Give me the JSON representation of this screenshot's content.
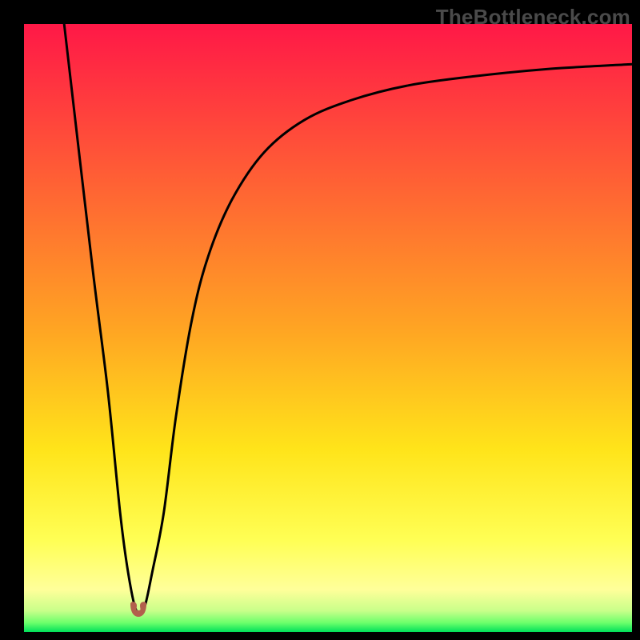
{
  "watermark": "TheBottleneck.com",
  "colors": {
    "frame_bg": "#000000",
    "curve_stroke": "#000000",
    "marker_fill": "#b2604c",
    "gradient_stops": [
      {
        "offset": 0.0,
        "hex": "#ff1847"
      },
      {
        "offset": 0.5,
        "hex": "#ffa423"
      },
      {
        "offset": 0.7,
        "hex": "#ffe41a"
      },
      {
        "offset": 0.85,
        "hex": "#ffff55"
      },
      {
        "offset": 0.93,
        "hex": "#ffff9a"
      },
      {
        "offset": 0.965,
        "hex": "#c9ff8a"
      },
      {
        "offset": 0.985,
        "hex": "#6bff6b"
      },
      {
        "offset": 1.0,
        "hex": "#00e05a"
      }
    ]
  },
  "chart_data": {
    "type": "line",
    "title": "",
    "xlabel": "",
    "ylabel": "",
    "xlim": [
      0,
      100
    ],
    "ylim": [
      0,
      100
    ],
    "legend": false,
    "grid": false,
    "notes": "Single cusp-curve. X is normalized horizontal position (0–100). Y is normalized vertical position from bottom (0) to top (100). Values estimated from pixel positions; no axis ticks are shown in the image.",
    "series": [
      {
        "name": "bottleneck-curve",
        "x": [
          6.6,
          11.2,
          13.8,
          15.8,
          17.1,
          18.4,
          19.7,
          21.1,
          23.0,
          25.0,
          27.6,
          30.3,
          34.2,
          39.5,
          46.1,
          53.9,
          63.2,
          74.0,
          86.2,
          100.0
        ],
        "y": [
          100.0,
          60.5,
          39.5,
          19.7,
          9.9,
          3.7,
          3.7,
          9.9,
          19.7,
          35.5,
          51.3,
          61.8,
          71.1,
          78.9,
          84.2,
          87.5,
          89.9,
          91.4,
          92.6,
          93.4
        ]
      }
    ],
    "marker": {
      "name": "cusp-minimum",
      "x": 18.8,
      "y": 3.3,
      "shape": "double-lobe"
    }
  }
}
